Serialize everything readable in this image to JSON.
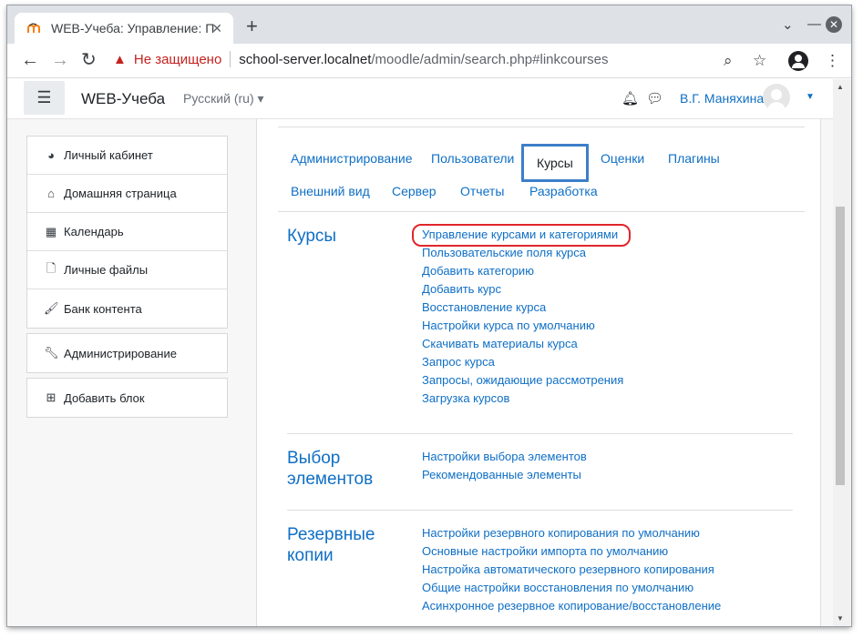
{
  "browser": {
    "tab_title": "WEB-Учеба: Управление: Поиск",
    "insecure_label": "Не защищено",
    "url_host": "school-server.localnet",
    "url_rest": "/moodle/admin/search.php#linkcourses"
  },
  "navbar": {
    "site_name": "WEB-Учеба",
    "language": "Русский (ru)",
    "user_name": "В.Г. Маняхина"
  },
  "sidebar": {
    "items": [
      {
        "label": "Личный кабинет",
        "icon": "dashboard-icon"
      },
      {
        "label": "Домашняя страница",
        "icon": "home-icon"
      },
      {
        "label": "Календарь",
        "icon": "calendar-icon"
      },
      {
        "label": "Личные файлы",
        "icon": "file-icon"
      },
      {
        "label": "Банк контента",
        "icon": "paintbrush-icon"
      }
    ],
    "admin": {
      "label": "Администрирование",
      "icon": "wrench-icon"
    },
    "add_block": {
      "label": "Добавить блок",
      "icon": "plus-square-icon"
    }
  },
  "tabs": {
    "row1": [
      "Администрирование",
      "Пользователи",
      "Курсы",
      "Оценки",
      "Плагины"
    ],
    "row2": [
      "Внешний вид",
      "Сервер",
      "Отчеты",
      "Разработка"
    ],
    "active": "Курсы"
  },
  "sections": [
    {
      "title": "Курсы",
      "links": [
        "Управление курсами и категориями",
        "Пользовательские поля курса",
        "Добавить категорию",
        "Добавить курс",
        "Восстановление курса",
        "Настройки курса по умолчанию",
        "Скачивать материалы курса",
        "Запрос курса",
        "Запросы, ожидающие рассмотрения",
        "Загрузка курсов"
      ]
    },
    {
      "title": "Выбор элементов",
      "links": [
        "Настройки выбора элементов",
        "Рекомендованные элементы"
      ]
    },
    {
      "title": "Резервные копии",
      "links": [
        "Настройки резервного копирования по умолчанию",
        "Основные настройки импорта по умолчанию",
        "Настройка автоматического резервного копирования",
        "Общие настройки восстановления по умолчанию",
        "Асинхронное резервное копирование/восстановление"
      ]
    }
  ],
  "colors": {
    "link": "#0f6fc5",
    "highlight": "#e0262b",
    "active_tab_border": "#3d7ec9"
  }
}
